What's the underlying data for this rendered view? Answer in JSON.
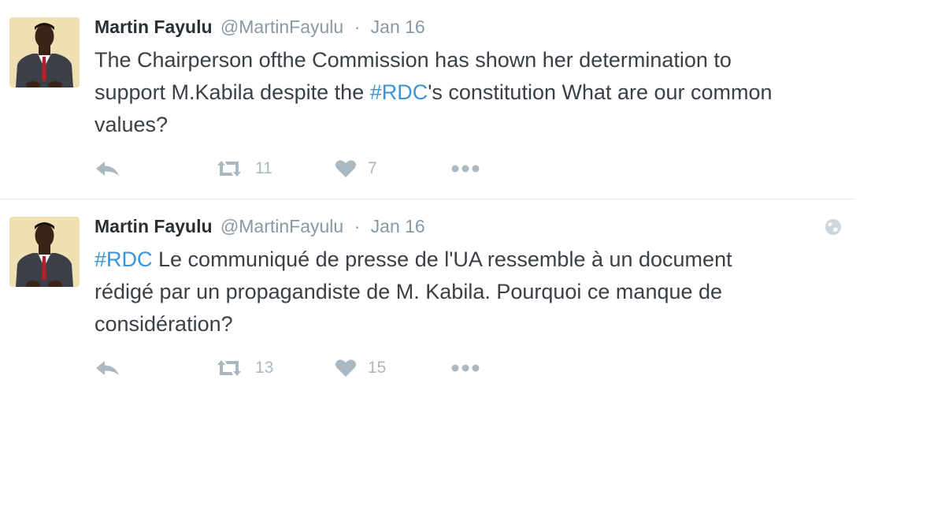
{
  "tweets": [
    {
      "author": {
        "name": "Martin Fayulu",
        "handle": "@MartinFayulu"
      },
      "time": "Jan 16",
      "text_parts": {
        "before": "The Chairperson ofthe Commission has shown her determination to",
        "line2_before": "support M.Kabila despite the ",
        "hashtag": "#RDC",
        "line2_after": "'s constitution What are our common",
        "line3": "values?"
      },
      "retweets": "11",
      "likes": "7"
    },
    {
      "author": {
        "name": "Martin Fayulu",
        "handle": "@MartinFayulu"
      },
      "time": "Jan 16",
      "text_parts": {
        "hashtag": "#RDC",
        "line1_after": " Le communiqué de presse de l'UA ressemble à un document",
        "line2": "rédigé par un propagandiste de M. Kabila. Pourquoi ce manque de",
        "line3": "considération?"
      },
      "retweets": "13",
      "likes": "15"
    }
  ],
  "separator": "·",
  "icons": {
    "reply": "reply-icon",
    "retweet": "retweet-icon",
    "like": "heart-icon",
    "more": "more-icon",
    "globe": "globe-icon",
    "avatar": "avatar"
  },
  "colors": {
    "name": "#292f33",
    "meta": "#8899a6",
    "text": "#3a4046",
    "hashtag": "#3b94d9",
    "action": "#aab8c2",
    "divider": "#e6ecf0"
  }
}
